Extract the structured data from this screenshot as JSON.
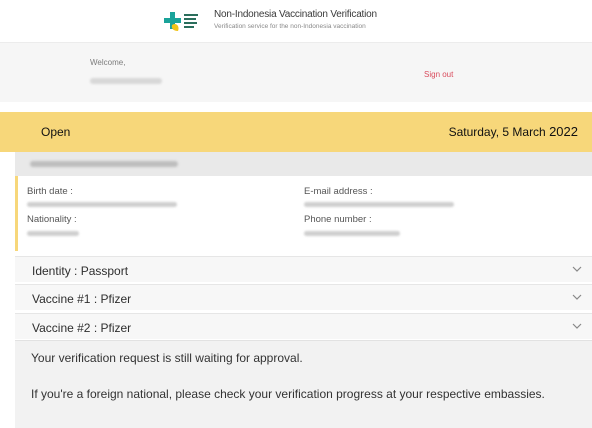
{
  "header": {
    "title": "Non-Indonesia Vaccination Verification",
    "subtitle": "Verification service for the non-Indonesia vaccination",
    "logo_icon": "kemenkes-logo"
  },
  "welcome": {
    "label": "Welcome,",
    "signout_label": "Sign out"
  },
  "status": {
    "left_label": "Open",
    "date_text": "Saturday, 5 March ",
    "year": "2022",
    "background": "#f7d77a"
  },
  "details": {
    "birth_date_label": "Birth date :",
    "nationality_label": "Nationality :",
    "email_label": "E-mail address :",
    "phone_label": "Phone number :"
  },
  "accordion": [
    {
      "label": "Identity : Passport",
      "icon": "chevron-down-icon"
    },
    {
      "label": "Vaccine #1 : Pfizer",
      "icon": "chevron-down-icon"
    },
    {
      "label": "Vaccine #2 : Pfizer",
      "icon": "chevron-down-icon"
    }
  ],
  "message": {
    "waiting": "Your verification request is still waiting for approval.",
    "foreign": "If you're a foreign national, please check your verification progress at your respective embassies."
  }
}
